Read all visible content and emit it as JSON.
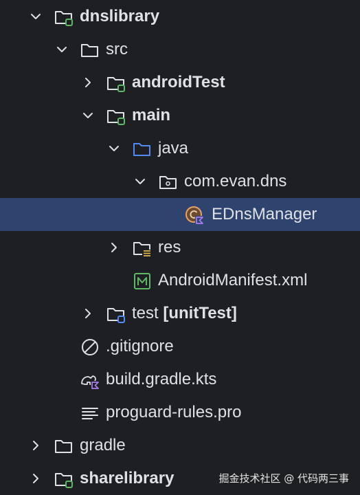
{
  "tree": {
    "items": [
      {
        "label": "dnslibrary"
      },
      {
        "label": "src"
      },
      {
        "label": "androidTest"
      },
      {
        "label": "main"
      },
      {
        "label": "java"
      },
      {
        "label": "com.evan.dns"
      },
      {
        "label": "EDnsManager"
      },
      {
        "label": "res"
      },
      {
        "label": "AndroidManifest.xml"
      },
      {
        "label": "test",
        "suffix": "[unitTest]"
      },
      {
        "label": ".gitignore"
      },
      {
        "label": "build.gradle.kts"
      },
      {
        "label": "proguard-rules.pro"
      },
      {
        "label": "gradle"
      },
      {
        "label": "sharelibrary"
      }
    ]
  },
  "colors": {
    "background": "#1e1f22",
    "selection": "#2e436e",
    "text": "#dfe1e5",
    "module_badge": "#5fb865",
    "java_folder": "#548af7",
    "kotlin_badge": "#a97cf0"
  },
  "watermark": "掘金技术社区 @ 代码两三事"
}
